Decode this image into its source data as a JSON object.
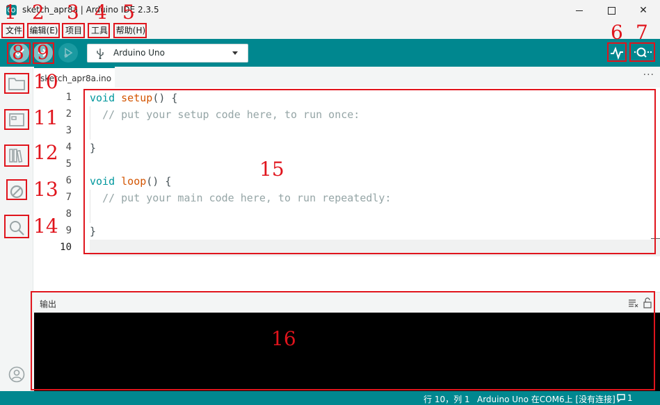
{
  "window": {
    "title": "sketch_apr8a | Arduino IDE 2.3.5",
    "controls": {
      "minimize": "",
      "maximize": "",
      "close": "✕"
    }
  },
  "menu": {
    "items": [
      {
        "label": "文件"
      },
      {
        "label": "编辑(E)"
      },
      {
        "label": "项目"
      },
      {
        "label": "工具"
      },
      {
        "label": "帮助(H)"
      }
    ]
  },
  "toolbar": {
    "board_name": "Arduino Uno",
    "icons": [
      "verify-icon",
      "upload-icon",
      "debug-icon",
      "usb-icon",
      "serial-plotter-icon",
      "serial-monitor-icon"
    ]
  },
  "tabs": [
    {
      "label": "sketch_apr8a.ino"
    }
  ],
  "tab_more": "···",
  "editor": {
    "line_numbers": [
      "1",
      "2",
      "3",
      "4",
      "5",
      "6",
      "7",
      "8",
      "9",
      "10"
    ],
    "current_line": "10",
    "code": {
      "kw": "void",
      "setup_fn": "setup",
      "paren_open": "() {",
      "setup_comment": "// put your setup code here, to run once:",
      "close_brace": "}",
      "loop_fn": "loop",
      "loop_comment": "// put your main code here, to run repeatedly:"
    }
  },
  "output": {
    "title": "输出"
  },
  "status": {
    "position": "行 10，列 1",
    "board_port": "Arduino Uno 在COM6上 [没有连接]",
    "notifications": "1"
  },
  "colors": {
    "accent": "#00878f",
    "annotation": "#e0141c"
  },
  "annotations": [
    "1",
    "2",
    "3",
    "4",
    "5",
    "6",
    "7",
    "8",
    "9",
    "10",
    "11",
    "12",
    "13",
    "14",
    "15",
    "16"
  ]
}
